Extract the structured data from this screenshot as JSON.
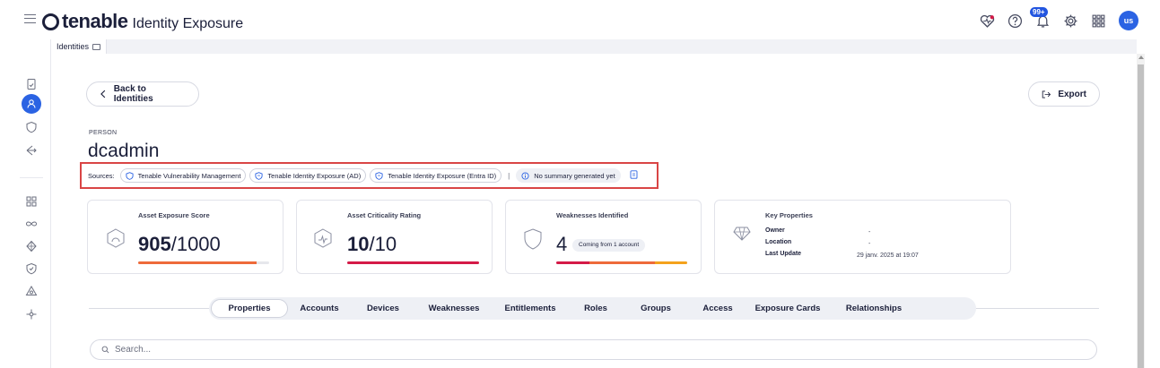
{
  "app": {
    "brand": "tenable",
    "product": "Identity Exposure",
    "notification_count": "99+",
    "user_initials": "us"
  },
  "tab_strip": {
    "active_tab": "Identities"
  },
  "actions": {
    "back_label": "Back to Identities",
    "export_label": "Export"
  },
  "entity": {
    "type": "PERSON",
    "name": "dcadmin"
  },
  "sources": {
    "label": "Sources:",
    "items": [
      "Tenable Vulnerability Management",
      "Tenable Identity Exposure (AD)",
      "Tenable Identity Exposure (Entra ID)"
    ],
    "summary": "No summary generated yet"
  },
  "cards": {
    "exposure": {
      "title": "Asset Exposure Score",
      "score": "905",
      "max": "/1000",
      "fraction": 0.905,
      "color": "#ee6a3a"
    },
    "criticality": {
      "title": "Asset Criticality Rating",
      "score": "10",
      "max": "/10",
      "fraction": 1.0,
      "color": "#d41a47"
    },
    "weaknesses": {
      "title": "Weaknesses Identified",
      "count": "4",
      "note": "Coming from 1 account",
      "segments": [
        {
          "color": "#d41a47",
          "fraction": 0.25
        },
        {
          "color": "#ee6a3a",
          "fraction": 0.5
        },
        {
          "color": "#f4a21c",
          "fraction": 0.25
        }
      ]
    },
    "key_properties": {
      "title": "Key Properties",
      "rows": [
        {
          "key": "Owner",
          "value": "-"
        },
        {
          "key": "Location",
          "value": "-"
        },
        {
          "key": "Last Update",
          "value": "29 janv. 2025 at 19:07"
        }
      ]
    }
  },
  "tabs": [
    "Properties",
    "Accounts",
    "Devices",
    "Weaknesses",
    "Entitlements",
    "Roles",
    "Groups",
    "Access",
    "Exposure Cards",
    "Relationships"
  ],
  "search": {
    "placeholder": "Search..."
  },
  "colors": {
    "accent": "#2b63e3",
    "highlight_border": "#d94545"
  }
}
